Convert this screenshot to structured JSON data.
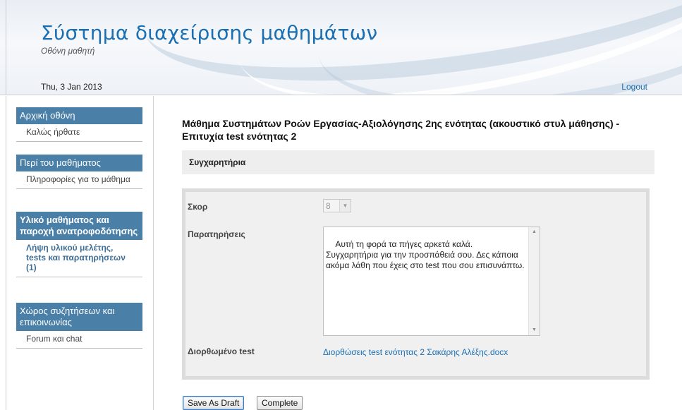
{
  "header": {
    "title": "Σύστημα διαχείρισης μαθημάτων",
    "subtitle": "Οθόνη μαθητή",
    "date": "Thu, 3 Jan 2013",
    "logout_label": "Logout"
  },
  "sidebar": {
    "groups": [
      {
        "header": "Αρχική οθόνη",
        "items": [
          "Καλώς ήρθατε"
        ]
      },
      {
        "header": "Περί του μαθήματος",
        "items": [
          "Πληροφορίες για το μάθημα"
        ]
      },
      {
        "header": "Υλικό μαθήματος και παροχή ανατροφοδότησης",
        "items": [
          "Λήψη υλικού μελέτης, tests και παρατηρήσεων (1)"
        ]
      },
      {
        "header": "Χώρος συζητήσεων και επικοινωνίας",
        "items": [
          "Forum και chat"
        ]
      }
    ]
  },
  "main": {
    "title": "Μάθημα Συστημάτων Ροών Εργασίας-Αξιολόγησης 2ης ενότητας (ακουστικό στυλ μάθησης) - Επιτυχία test ενότητας 2",
    "section_label": "Συγχαρητήρια",
    "form": {
      "score_label": "Σκορ",
      "score_value": "8",
      "remarks_label": "Παρατηρήσεις",
      "remarks_text": "Αυτή τη φορά τα πήγες αρκετά καλά. Συγχαρητήρια για την προσπάθειά σου. Δες κάποια ακόμα λάθη που έχεις στο test που σου επισυνάπτω.",
      "corrected_label": "Διορθωμένο test",
      "corrected_file": "Διορθώσεις test ενότητας 2 Σακάρης Αλέξης.docx"
    },
    "buttons": {
      "save_draft": "Save As Draft",
      "complete": "Complete"
    }
  }
}
